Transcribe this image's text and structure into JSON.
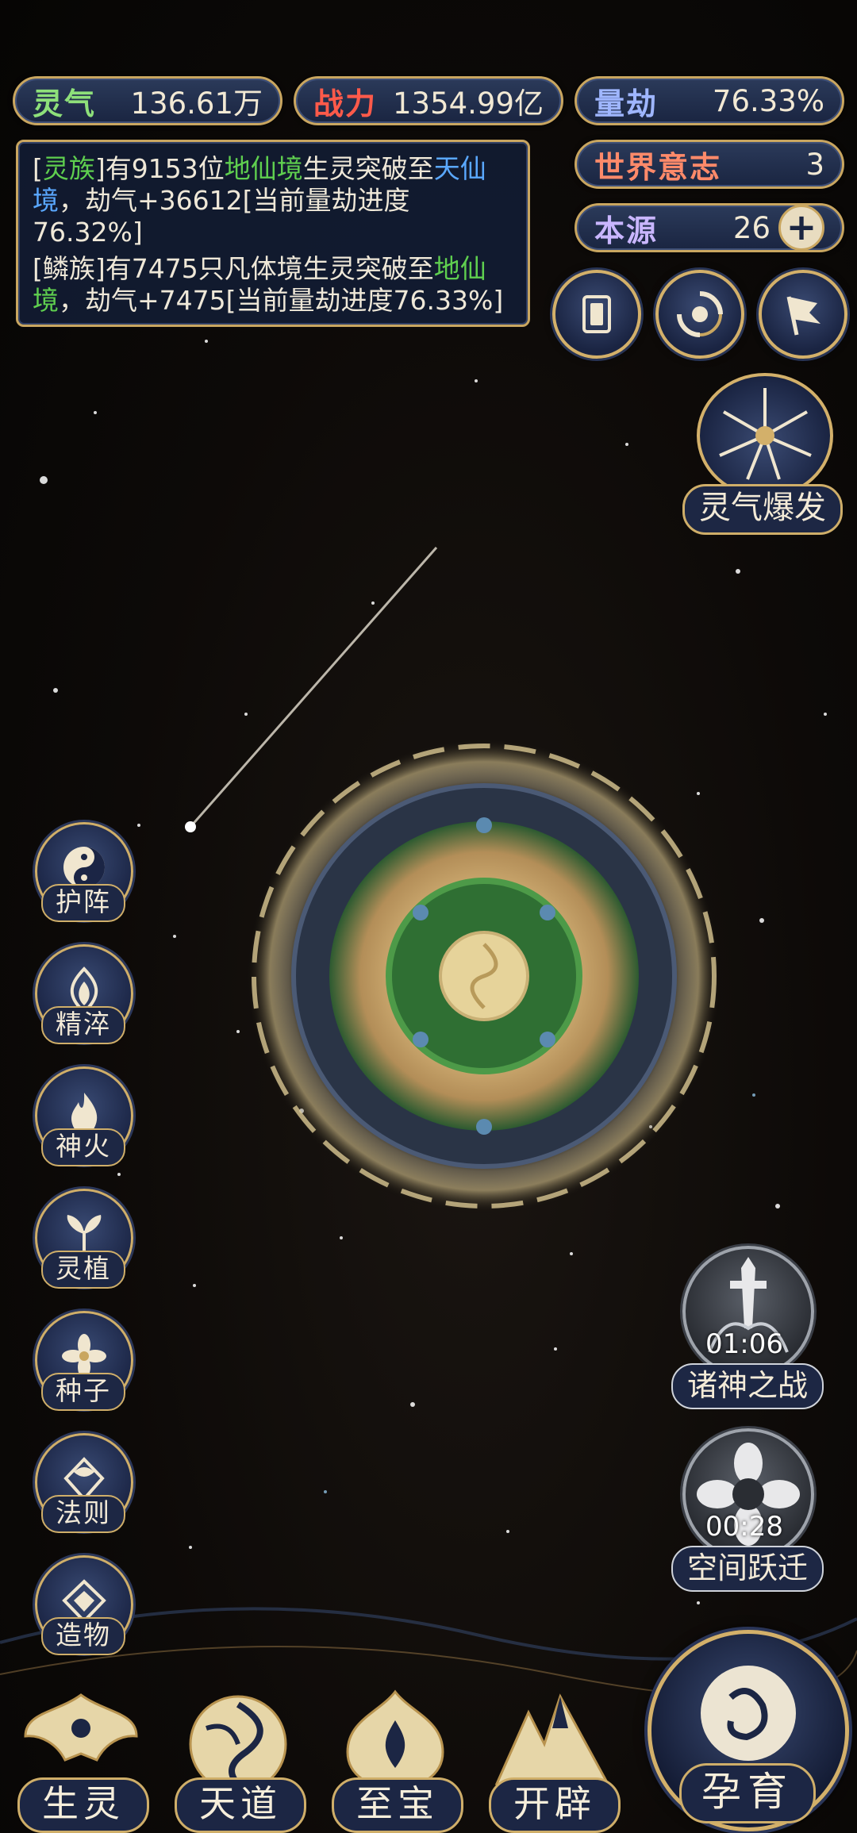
{
  "resources": {
    "lingqi": {
      "label": "灵气",
      "value": "136.61万",
      "color": "#8ee07a"
    },
    "zhanli": {
      "label": "战力",
      "value": "1354.99亿",
      "color": "#ff5a4a"
    },
    "liangjie": {
      "label": "量劫",
      "value": "76.33%",
      "color": "#9fb6ff"
    },
    "shijie_yizhi": {
      "label": "世界意志",
      "value": "3",
      "color": "#ff8a6a"
    },
    "benyuan": {
      "label": "本源",
      "value": "26",
      "color": "#c9b6ff"
    }
  },
  "messages": [
    {
      "p1": "[",
      "race": "灵族",
      "p2": "]有9153位",
      "from": "地仙境",
      "p3": "生灵突破至",
      "to": "天仙境",
      "p4": "，劫气+36612[当前量劫进度76.32%]"
    },
    {
      "p1": "[鳞族]有7475只凡体境生灵突破至",
      "to": "地仙境",
      "p4": "，劫气+7475[当前量劫进度76.33%]"
    }
  ],
  "burst": {
    "label": "灵气爆发"
  },
  "side_menu": [
    {
      "label": "护阵",
      "icon": "yin-yang-icon"
    },
    {
      "label": "精淬",
      "icon": "flame-crest-icon"
    },
    {
      "label": "神火",
      "icon": "fire-icon"
    },
    {
      "label": "灵植",
      "icon": "plant-icon"
    },
    {
      "label": "种子",
      "icon": "seed-flower-icon"
    },
    {
      "label": "法则",
      "icon": "rune-icon"
    },
    {
      "label": "造物",
      "icon": "diamond-icon"
    }
  ],
  "events": {
    "gods_war": {
      "label": "诸神之战",
      "timer": "01:06"
    },
    "space_jump": {
      "label": "空间跃迁",
      "timer": "00:28"
    }
  },
  "bottom_nav": [
    {
      "label": "生灵",
      "icon": "phoenix-icon"
    },
    {
      "label": "天道",
      "icon": "swirl-icon"
    },
    {
      "label": "至宝",
      "icon": "treasure-icon"
    },
    {
      "label": "开辟",
      "icon": "mountain-icon"
    }
  ],
  "breed": {
    "label": "孕育"
  },
  "colors": {
    "gold": "#c9a660",
    "navy": "#1a2541",
    "green_text": "#5fcf4f",
    "blue_text": "#5aa8ff"
  }
}
